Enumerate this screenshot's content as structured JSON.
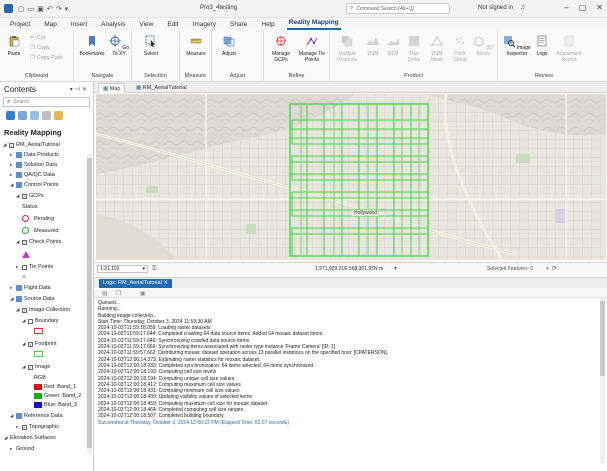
{
  "titlebar": {
    "project": "Pro3_4testing",
    "search_placeholder": "Command Search (Alt+Q)",
    "signin": "Not signed in"
  },
  "tabs": [
    "Project",
    "Map",
    "Insert",
    "Analysis",
    "View",
    "Edit",
    "Imagery",
    "Share",
    "Help",
    "Reality Mapping"
  ],
  "ribbon": {
    "clipboard": {
      "paste": "Paste",
      "cut": "Cut",
      "copy": "Copy",
      "copy_path": "Copy Path",
      "label": "Clipboard"
    },
    "navigate": {
      "bookmarks": "Bookmarks",
      "goto": "Go To XY",
      "label": "Navigate"
    },
    "selection": {
      "select": "Select",
      "label": "Selection"
    },
    "measure": {
      "measure": "Measure",
      "label": "Measure"
    },
    "adjust": {
      "adjust": "Adjust",
      "label": "Adjust"
    },
    "refine": {
      "manage_gcps": "Manage GCPs",
      "manage_tie": "Manage Tie Points",
      "label": "Refine"
    },
    "product": {
      "multiple": "Multiple Products",
      "dsm": "DSM",
      "dtm": "DTM",
      "true_ortho": "True Ortho",
      "dsm_mesh": "DSM Mesh",
      "point_cloud": "Point Cloud",
      "mesh_3d": "3D Mesh",
      "label": "Product"
    },
    "review": {
      "image_inspector": "Image Inspector",
      "logs": "Logs",
      "adj_report": "Adjustment Report",
      "label": "Review"
    }
  },
  "contents": {
    "title": "Contents",
    "search_placeholder": "Search",
    "root": "Reality Mapping",
    "items": {
      "tutorial": "RM_AerialTutorial",
      "data_products": "Data Products",
      "solution_data": "Solution Data",
      "qaqc": "QA/QC Data",
      "control_points": "Control Points",
      "gcps": "GCPs",
      "status": "Status",
      "pending": "Pending",
      "measured": "Measured",
      "check_points": "Check Points",
      "tie_points": "Tie Points",
      "flight_data": "Flight Data",
      "source_data": "Source Data",
      "image_collection": "Image Collection",
      "boundary": "Boundary",
      "footprint": "Footprint",
      "image": "Image",
      "rgb": "RGB",
      "red": "Red:  Band_1",
      "green": "Green: Band_2",
      "blue": "Blue:  Band_3",
      "reference_data": "Reference Data",
      "topographic": "Topographic",
      "elevation_surfaces": "Elevation Surfaces",
      "ground": "Ground"
    }
  },
  "mapview": {
    "tab_map": "Map",
    "tab_tutorial": "RM_AerialTutorial",
    "scale": "1:21,119",
    "coords": "1,971,929.21E 568,301.97N m",
    "selected": "Selected Features: 0",
    "label_hollywood": "Hollywood"
  },
  "logs": {
    "tab": "Logs: RM_AerialTutorial",
    "lines": [
      "Queued...",
      "Running...",
      "Building image collection...",
      "Start Time: Thursday, October 3, 2024 11:59:30 AM",
      "2024-10-03T11:59:18.059: Loading raster datasets",
      "2024-10-03T11:59:17.644: Completed crawling 64 data source items. Added 64 mosaic dataset items.",
      "2024-10-03T11:59:17.646: Synchronizing crawled data source items",
      "2024-10-03T11:59:17.659: Synchronizing items associated with raster type instance 'Frame Camera' [ID: 1].",
      "2024-10-03T11:59:57.662: Distributing mosaic dataset operation across 13 parallel instances on the specified host: [CPATERSON].",
      "2024-10-03T12:00:14.373: Estimating raster statistics for mosaic dataset.",
      "2024-10-03T12:00:18.033: Completed synchronization: 64 items selected, 64 items synchronized.",
      "2024-10-03T12:00:18.193: Computing cell size levels",
      "2024-10-03T12:00:18.194: Computing unique cell size values",
      "2024-10-03T12:00:18.412: Computing maximum cell size values",
      "2024-10-03T12:00:18.431: Computing minimum cell size values",
      "2024-10-03T12:00:18.439: Updating visibility values of selected items",
      "2024-10-03T12:00:18.459: Computing maximum cell size for mosaic dataset",
      "2024-10-03T12:00:18.464: Completed computing cell size ranges.",
      "2024-10-03T12:00:18.507: Completed building boundary.",
      "Succeeded at Thursday, October 3, 2024 12:00:22 PM (Elapsed Time: 52.07 seconds)"
    ]
  },
  "colors": {
    "accent": "#1e6ab3",
    "footprint": "#39d939",
    "red_band": "#e01010",
    "green_band": "#10b010",
    "blue_band": "#1010d0"
  }
}
